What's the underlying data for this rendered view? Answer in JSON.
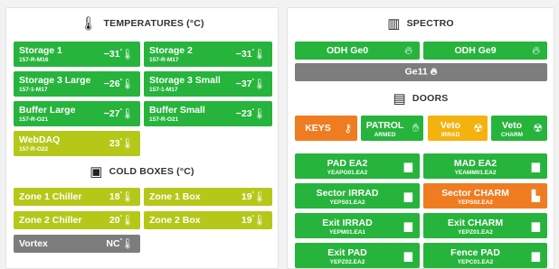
{
  "temperatures": {
    "title": "TEMPERATURES (°C)",
    "tiles": [
      {
        "name": "Storage 1",
        "code": "157-R-M16",
        "value": "−31"
      },
      {
        "name": "Storage 2",
        "code": "157-R-M17",
        "value": "−31"
      },
      {
        "name": "Storage 3 Large",
        "code": "157-1-M17",
        "value": "−26"
      },
      {
        "name": "Storage 3 Small",
        "code": "157-1-M17",
        "value": "−37"
      },
      {
        "name": "Buffer Large",
        "code": "157-R-O21",
        "value": "−27"
      },
      {
        "name": "Buffer Small",
        "code": "157-R-O21",
        "value": "−23"
      },
      {
        "name": "WebDAQ",
        "code": "157-R-O22",
        "value": "23"
      }
    ]
  },
  "cold_boxes": {
    "title": "COLD BOXES (°C)",
    "tiles": [
      {
        "name": "Zone 1 Chiller",
        "value": "18"
      },
      {
        "name": "Zone 1 Box",
        "value": "19"
      },
      {
        "name": "Zone 2 Chiller",
        "value": "20"
      },
      {
        "name": "Zone 2 Box",
        "value": "19"
      },
      {
        "name": "Vortex",
        "value": "NC"
      }
    ]
  },
  "degree_mark": "°",
  "spectro": {
    "title": "SPECTRO",
    "buttons": [
      {
        "label": "ODH Ge0"
      },
      {
        "label": "ODH Ge9"
      },
      {
        "label": "Ge11"
      }
    ]
  },
  "doors": {
    "title": "DOORS",
    "top_row": [
      {
        "label": "KEYS",
        "sub": ""
      },
      {
        "label": "PATROL",
        "sub": "ARMED"
      },
      {
        "label": "Veto",
        "sub": "IRRAD"
      },
      {
        "label": "Veto",
        "sub": "CHARM"
      }
    ],
    "grid": [
      {
        "label": "PAD EA2",
        "sub": "YEAPG01.EA2"
      },
      {
        "label": "MAD EA2",
        "sub": "YEAMM01.EA2"
      },
      {
        "label": "Sector IRRAD",
        "sub": "YEPS01.EA2"
      },
      {
        "label": "Sector CHARM",
        "sub": "YEPS02.EA2"
      },
      {
        "label": "Exit IRRAD",
        "sub": "YEPM01.EA1"
      },
      {
        "label": "Exit CHARM",
        "sub": "YEPZ01.EA2"
      },
      {
        "label": "Exit PAD",
        "sub": "YEPZ02.EA2"
      },
      {
        "label": "Fence PAD",
        "sub": "YEPC01.EA2"
      }
    ]
  },
  "colors": {
    "ok": "#27b43c",
    "warm": "#b5c81a",
    "offline": "#7d7d7d",
    "alert": "#f07c21",
    "veto": "#f4b20f"
  }
}
